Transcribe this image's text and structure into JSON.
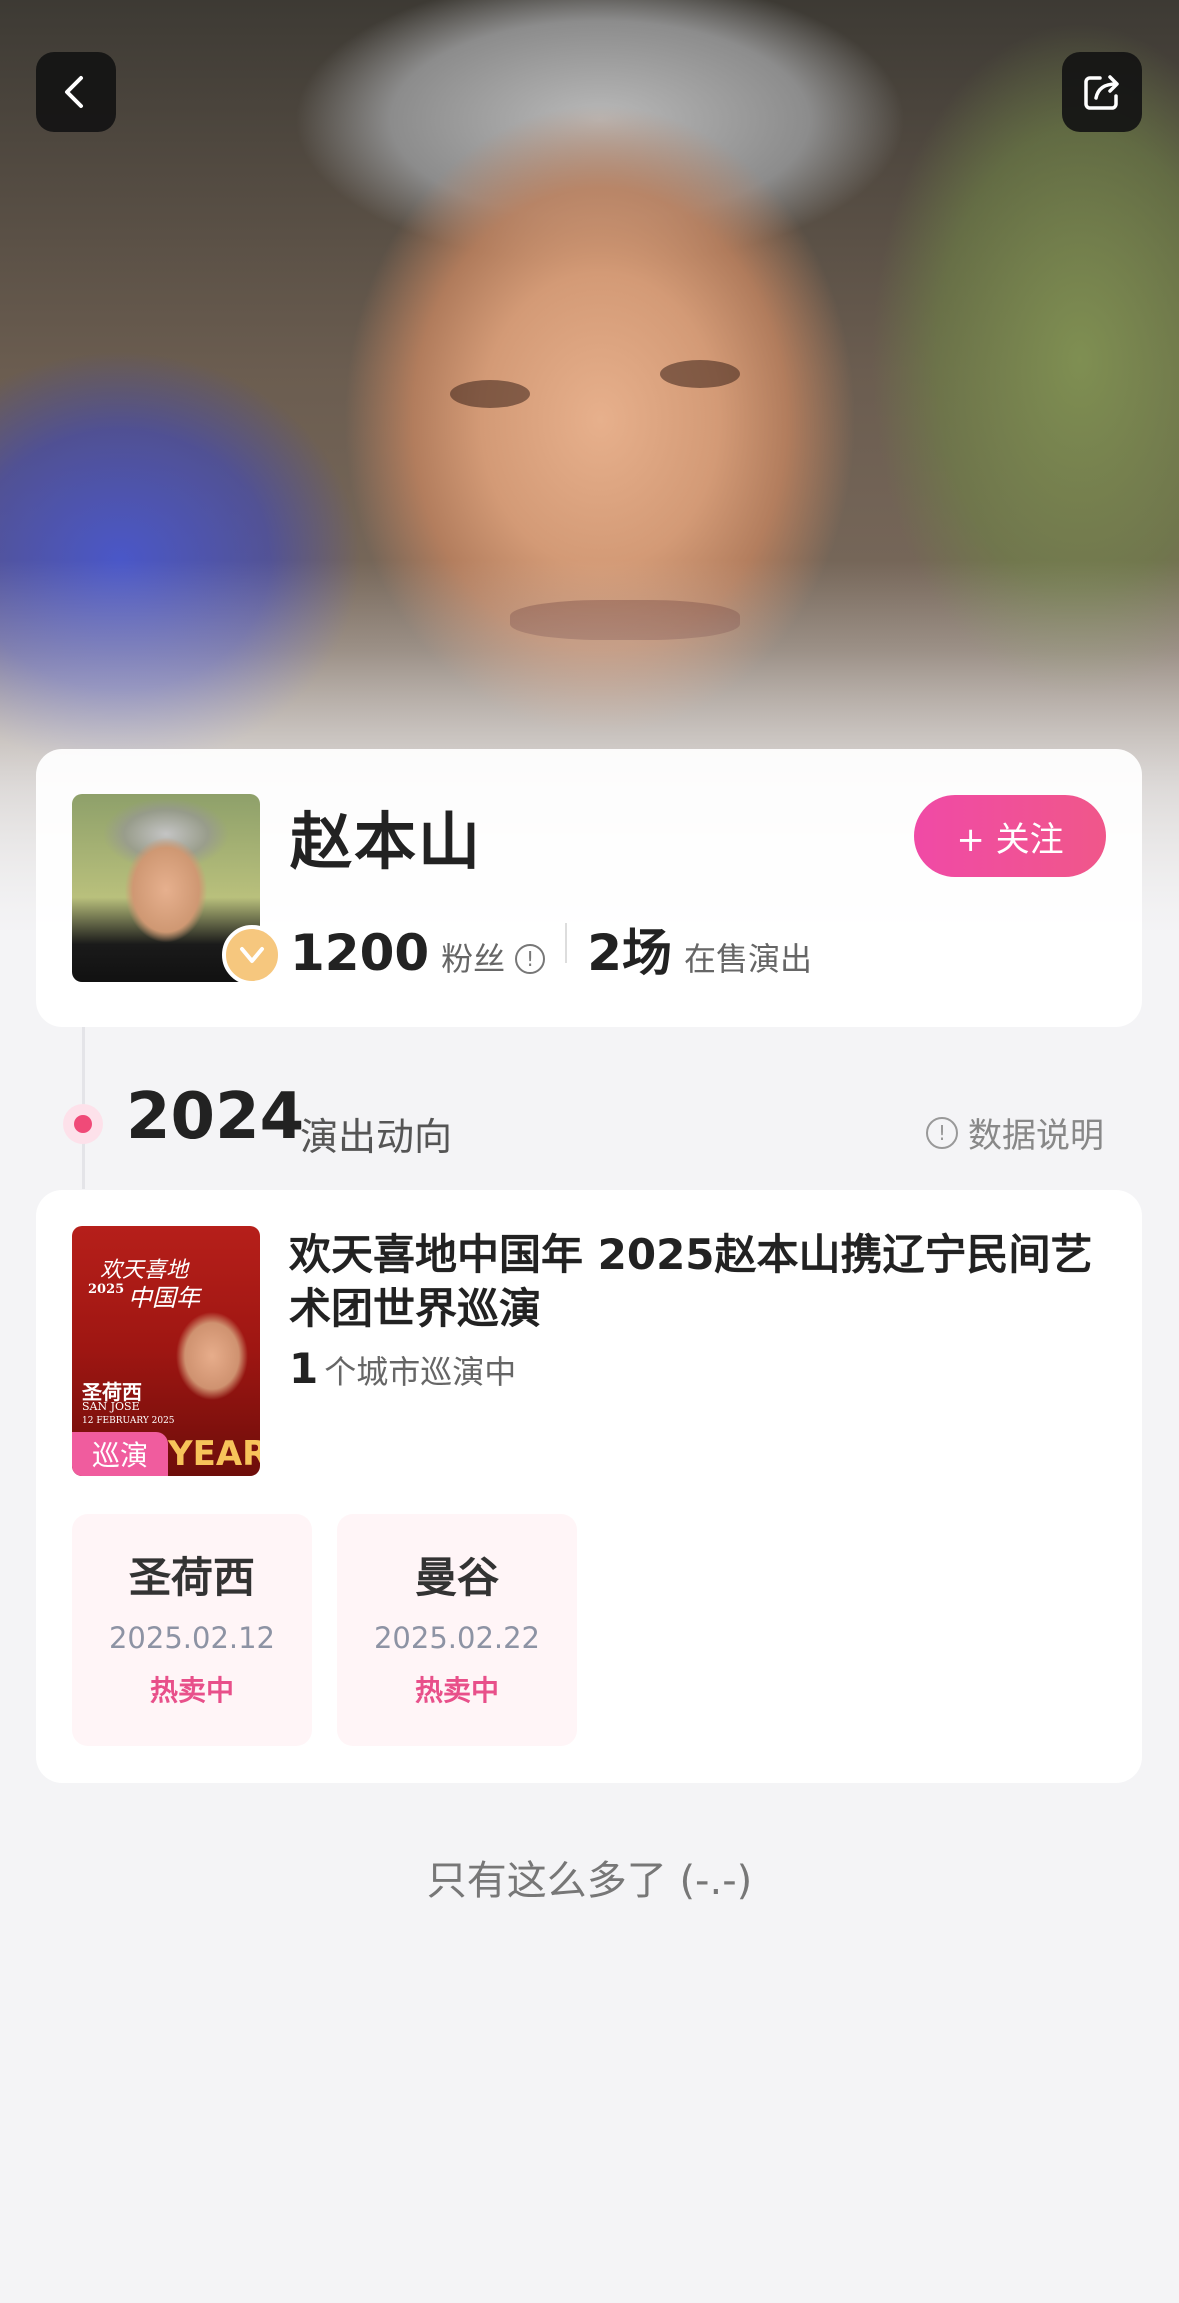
{
  "artist": {
    "name": "赵本山",
    "fans_count": "1200",
    "fans_label": "粉丝",
    "shows_count": "2场",
    "shows_label": "在售演出",
    "follow_label": "+ 关注"
  },
  "timeline": {
    "year": "2024",
    "label": "演出动向",
    "data_note": "数据说明"
  },
  "show": {
    "title": "欢天喜地中国年 2025赵本山携辽宁民间艺术团世界巡演",
    "city_count": "1",
    "city_label": "个城市巡演中",
    "tag": "巡演",
    "poster_text": {
      "line1": "欢天喜地",
      "line2": "2025",
      "line3": "中国年",
      "city": "圣荷西",
      "city_en": "SAN JOSE",
      "date": "12 FEBRUARY 2025",
      "year_word": "YEAR"
    },
    "cities": [
      {
        "name": "圣荷西",
        "date": "2025.02.12",
        "status": "热卖中"
      },
      {
        "name": "曼谷",
        "date": "2025.02.22",
        "status": "热卖中"
      }
    ]
  },
  "footer": "只有这么多了 (-.-)",
  "colors": {
    "accent": "#f04a78",
    "follow_gradient_start": "#f04aa6",
    "follow_gradient_end": "#f0578a",
    "status": "#e8508a"
  },
  "icons": [
    "back-arrow-icon",
    "share-icon",
    "verified-v-icon",
    "info-icon"
  ]
}
